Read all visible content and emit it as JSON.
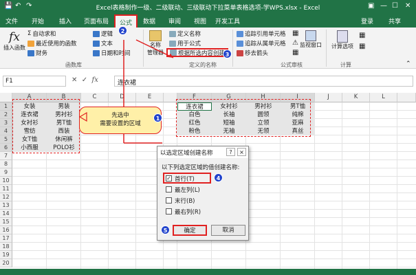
{
  "titlebar": {
    "title": "Excel表格制作一级、二级联动、三级联动下拉菜单表格选项-学WPS.xlsx - Excel",
    "quick_access": [
      "save-icon",
      "undo-icon",
      "redo-icon"
    ],
    "window_controls": [
      "ribbon-options-icon",
      "minimize-icon",
      "maximize-icon",
      "close-icon"
    ]
  },
  "tabs": [
    "文件",
    "开始",
    "插入",
    "页面布局",
    "公式",
    "数据",
    "审阅",
    "视图",
    "开发工具"
  ],
  "tabs_right": {
    "login": "登录",
    "share": "共享"
  },
  "ribbon": {
    "insert_function": "插入函数",
    "autosum": "自动求和",
    "recent": "最近使用的函数",
    "financial": "财务",
    "logical": "逻辑",
    "text": "文本",
    "datetime": "日期和时间",
    "library_label": "函数库",
    "name_manager": "名称\n管理器",
    "define_name": "定义名称",
    "use_in_formula": "用于公式",
    "create_from_selection": "根据所选内容创建",
    "defined_names_label": "定义的名称",
    "trace_precedents": "追踪引用单元格",
    "trace_dependents": "追踪从属单元格",
    "remove_arrows": "移去箭头",
    "watch_window": "监视窗口",
    "audit_label": "公式审核",
    "calc_options": "计算选项",
    "calc_label": "计算"
  },
  "formula_bar": {
    "name_box": "F1",
    "content": "连衣裙"
  },
  "columns": [
    "A",
    "B",
    "C",
    "D",
    "E",
    "F",
    "G",
    "H",
    "I",
    "J",
    "K",
    "L"
  ],
  "rows": [
    "1",
    "2",
    "3",
    "4",
    "5",
    "6",
    "7",
    "8",
    "9",
    "10",
    "11",
    "12",
    "13",
    "14",
    "15",
    "16",
    "17",
    "18",
    "19",
    "20"
  ],
  "cells_ab": [
    [
      "女装",
      "男装"
    ],
    [
      "连衣裙",
      "男衬衫"
    ],
    [
      "女衬衫",
      "男T恤"
    ],
    [
      "雪纺",
      "西装"
    ],
    [
      "女T恤",
      "休闲裤"
    ],
    [
      "小西服",
      "POLO衫"
    ]
  ],
  "cells_fi": [
    [
      "连衣裙",
      "女衬衫",
      "男衬衫",
      "男T恤"
    ],
    [
      "白色",
      "长袖",
      "圆领",
      "纯棉"
    ],
    [
      "红色",
      "短袖",
      "立领",
      "亚麻"
    ],
    [
      "粉色",
      "无袖",
      "无领",
      "真丝"
    ]
  ],
  "callout": {
    "line1": "先选中",
    "line2": "需要设置的区域"
  },
  "markers": [
    "1",
    "2",
    "3",
    "4",
    "5"
  ],
  "dialog": {
    "title": "以选定区域创建名称",
    "help": "?",
    "close": "×",
    "prompt": "以下列选定区域的值创建名称:",
    "options": [
      {
        "label": "首行(T)",
        "checked": true
      },
      {
        "label": "最左列(L)",
        "checked": false
      },
      {
        "label": "末行(B)",
        "checked": false
      },
      {
        "label": "最右列(R)",
        "checked": false
      }
    ],
    "ok": "确定",
    "cancel": "取消"
  },
  "colors": {
    "excel_green": "#217346",
    "annotation_red": "#e02020",
    "marker_blue": "#2244cc",
    "callout_yellow": "#fff0a8"
  }
}
